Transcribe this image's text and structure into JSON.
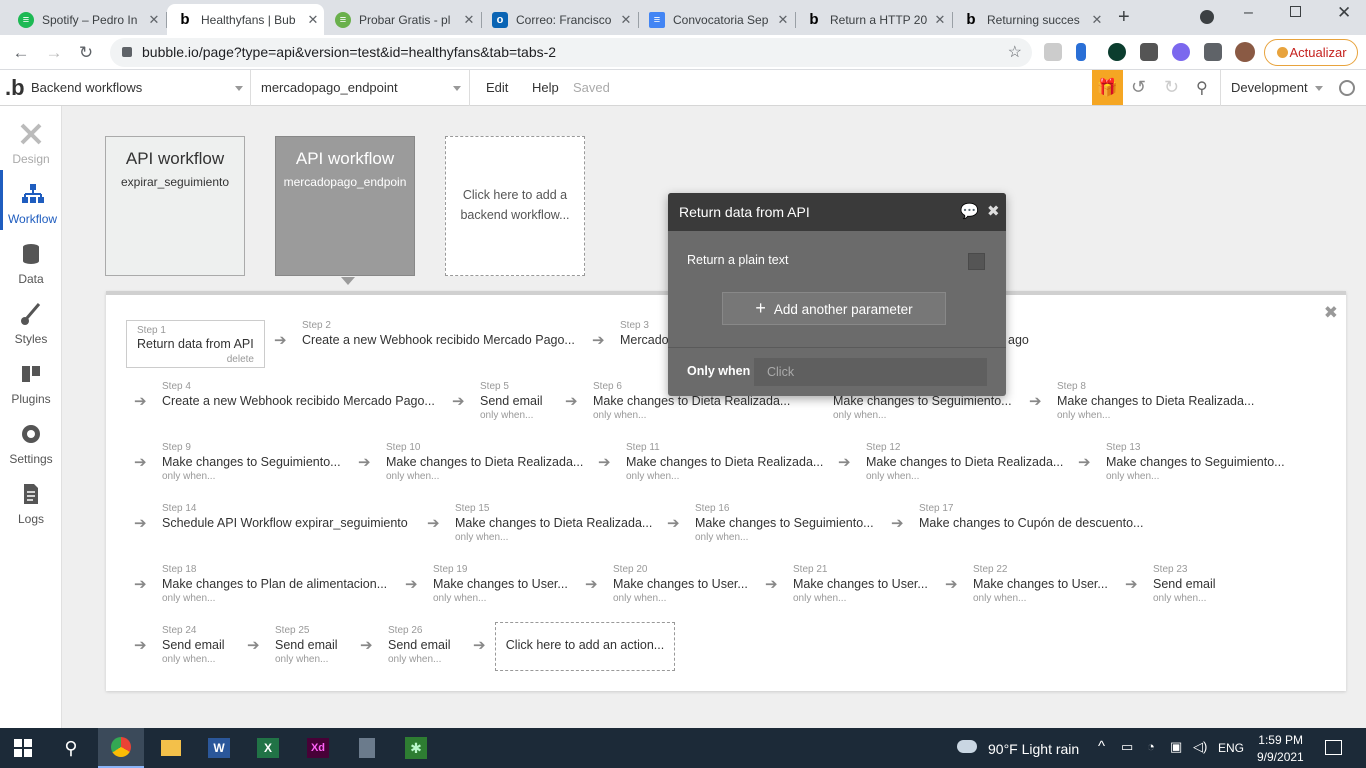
{
  "browser_tabs": [
    {
      "title": "Spotify – Pedro In",
      "icon": "spotify-icon",
      "color": "#1db954"
    },
    {
      "title": "Healthyfans | Bub",
      "icon": "bubble-icon",
      "color": "#000000"
    },
    {
      "title": "Probar Gratis - pl",
      "icon": "green-icon",
      "color": "#6ab04c"
    },
    {
      "title": "Correo: Francisco",
      "icon": "outlook-icon",
      "color": "#0a64b4"
    },
    {
      "title": "Convocatoria Sep",
      "icon": "docs-icon",
      "color": "#4285f4"
    },
    {
      "title": "Return a HTTP 20",
      "icon": "bubble-icon",
      "color": "#000000"
    },
    {
      "title": "Returning succes",
      "icon": "bubble-icon",
      "color": "#000000"
    }
  ],
  "address": {
    "url": "bubble.io/page?type=api&version=test&id=healthyfans&tab=tabs-2",
    "update_label": "Actualizar"
  },
  "bubble": {
    "workflow_section": "Backend workflows",
    "endpoint": "mercadopago_endpoint",
    "menu": {
      "edit": "Edit",
      "help": "Help",
      "status": "Saved"
    },
    "env": "Development"
  },
  "sidebar": [
    {
      "label": "Design",
      "icon": "design-icon"
    },
    {
      "label": "Workflow",
      "icon": "workflow-icon"
    },
    {
      "label": "Data",
      "icon": "data-icon"
    },
    {
      "label": "Styles",
      "icon": "styles-icon"
    },
    {
      "label": "Plugins",
      "icon": "plugins-icon"
    },
    {
      "label": "Settings",
      "icon": "settings-icon"
    },
    {
      "label": "Logs",
      "icon": "logs-icon"
    }
  ],
  "workflow_cards": [
    {
      "title": "API workflow",
      "name": "expirar_seguimiento"
    },
    {
      "title": "API workflow",
      "name": "mercadopago_endpoin"
    },
    {
      "add_label": "Click here to add a backend workflow..."
    }
  ],
  "steps": [
    {
      "n": "Step 1",
      "text": "Return data from API",
      "cond": "delete"
    },
    {
      "n": "Step 2",
      "text": "Create a new Webhook recibido Mercado Pago...",
      "cond": ""
    },
    {
      "n": "Step 3",
      "text": "Mercado",
      "cond": ""
    },
    {
      "n": "",
      "text": "ago",
      "cond": ""
    },
    {
      "n": "Step 4",
      "text": "Create a new Webhook recibido Mercado Pago...",
      "cond": ""
    },
    {
      "n": "Step 5",
      "text": "Send email",
      "cond": "only when..."
    },
    {
      "n": "Step 6",
      "text": "Make changes to Dieta Realizada...",
      "cond": "only when..."
    },
    {
      "n": "",
      "text": "Make changes to Seguimiento...",
      "cond": "only when..."
    },
    {
      "n": "Step 8",
      "text": "Make changes to Dieta Realizada...",
      "cond": "only when..."
    },
    {
      "n": "Step 9",
      "text": "Make changes to Seguimiento...",
      "cond": "only when..."
    },
    {
      "n": "Step 10",
      "text": "Make changes to Dieta Realizada...",
      "cond": "only when..."
    },
    {
      "n": "Step 11",
      "text": "Make changes to Dieta Realizada...",
      "cond": "only when..."
    },
    {
      "n": "Step 12",
      "text": "Make changes to Dieta Realizada...",
      "cond": "only when..."
    },
    {
      "n": "Step 13",
      "text": "Make changes to Seguimiento...",
      "cond": "only when..."
    },
    {
      "n": "Step 14",
      "text": "Schedule API Workflow expirar_seguimiento",
      "cond": ""
    },
    {
      "n": "Step 15",
      "text": "Make changes to Dieta Realizada...",
      "cond": "only when..."
    },
    {
      "n": "Step 16",
      "text": "Make changes to Seguimiento...",
      "cond": "only when..."
    },
    {
      "n": "Step 17",
      "text": "Make changes to Cupón de descuento...",
      "cond": ""
    },
    {
      "n": "Step 18",
      "text": "Make changes to Plan de alimentacion...",
      "cond": "only when..."
    },
    {
      "n": "Step 19",
      "text": "Make changes to User...",
      "cond": "only when..."
    },
    {
      "n": "Step 20",
      "text": "Make changes to User...",
      "cond": "only when..."
    },
    {
      "n": "Step 21",
      "text": "Make changes to User...",
      "cond": "only when..."
    },
    {
      "n": "Step 22",
      "text": "Make changes to User...",
      "cond": "only when..."
    },
    {
      "n": "Step 23",
      "text": "Send email",
      "cond": "only when..."
    },
    {
      "n": "Step 24",
      "text": "Send email",
      "cond": "only when..."
    },
    {
      "n": "Step 25",
      "text": "Send email",
      "cond": "only when..."
    },
    {
      "n": "Step 26",
      "text": "Send email",
      "cond": "only when..."
    }
  ],
  "add_action": "Click here to add an action...",
  "popup": {
    "title": "Return data from API",
    "plain_text_label": "Return a plain text",
    "add_param": "Add another parameter",
    "only_when": "Only when",
    "only_when_placeholder": "Click"
  },
  "taskbar": {
    "weather": "90°F  Light rain",
    "lang": "ENG",
    "time": "1:59 PM",
    "date": "9/9/2021"
  }
}
